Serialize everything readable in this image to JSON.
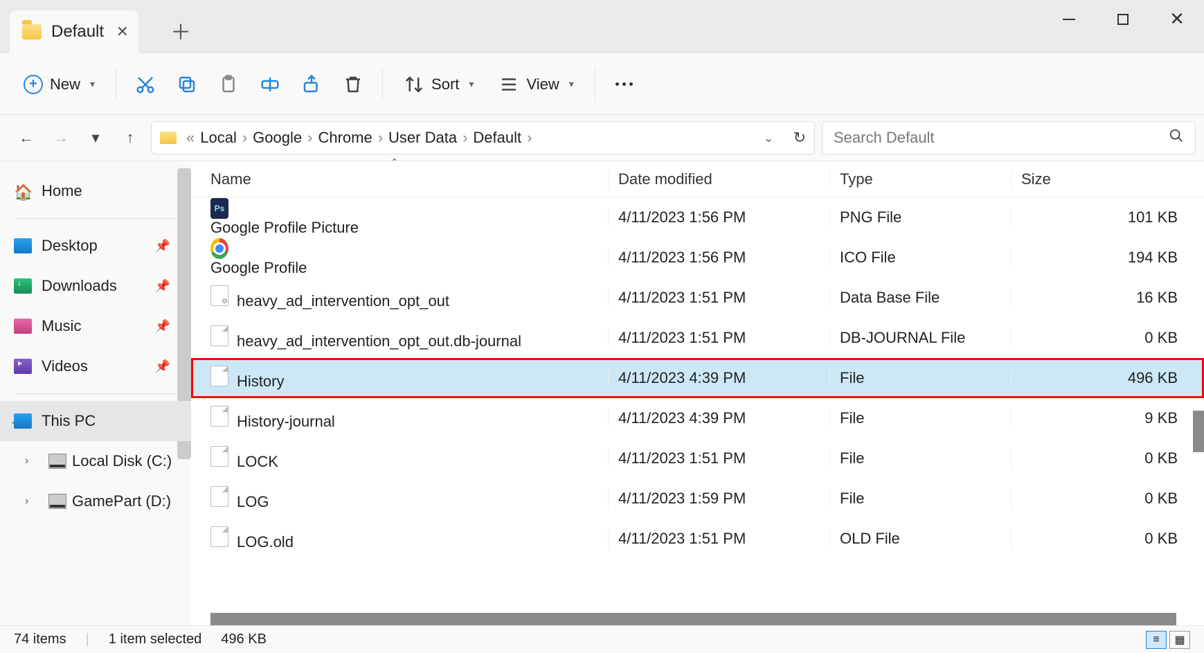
{
  "window": {
    "tab_title": "Default",
    "minimize": "–",
    "maximize": "□",
    "close": "✕"
  },
  "toolbar": {
    "new_label": "New",
    "sort_label": "Sort",
    "view_label": "View"
  },
  "nav": {
    "breadcrumbs": [
      "Local",
      "Google",
      "Chrome",
      "User Data",
      "Default"
    ],
    "search_placeholder": "Search Default"
  },
  "sidebar": {
    "home": "Home",
    "desktop": "Desktop",
    "downloads": "Downloads",
    "music": "Music",
    "videos": "Videos",
    "this_pc": "This PC",
    "local_disk": "Local Disk (C:)",
    "gamepart": "GamePart (D:)"
  },
  "columns": {
    "name": "Name",
    "date": "Date modified",
    "type": "Type",
    "size": "Size"
  },
  "files": [
    {
      "name": "Google Profile Picture",
      "date": "4/11/2023 1:56 PM",
      "type": "PNG File",
      "size": "101 KB",
      "icon": "ps",
      "selected": false
    },
    {
      "name": "Google Profile",
      "date": "4/11/2023 1:56 PM",
      "type": "ICO File",
      "size": "194 KB",
      "icon": "chrome",
      "selected": false
    },
    {
      "name": "heavy_ad_intervention_opt_out",
      "date": "4/11/2023 1:51 PM",
      "type": "Data Base File",
      "size": "16 KB",
      "icon": "db",
      "selected": false
    },
    {
      "name": "heavy_ad_intervention_opt_out.db-journal",
      "date": "4/11/2023 1:51 PM",
      "type": "DB-JOURNAL File",
      "size": "0 KB",
      "icon": "blank",
      "selected": false
    },
    {
      "name": "History",
      "date": "4/11/2023 4:39 PM",
      "type": "File",
      "size": "496 KB",
      "icon": "blank",
      "selected": true
    },
    {
      "name": "History-journal",
      "date": "4/11/2023 4:39 PM",
      "type": "File",
      "size": "9 KB",
      "icon": "blank",
      "selected": false
    },
    {
      "name": "LOCK",
      "date": "4/11/2023 1:51 PM",
      "type": "File",
      "size": "0 KB",
      "icon": "blank",
      "selected": false
    },
    {
      "name": "LOG",
      "date": "4/11/2023 1:59 PM",
      "type": "File",
      "size": "0 KB",
      "icon": "blank",
      "selected": false
    },
    {
      "name": "LOG.old",
      "date": "4/11/2023 1:51 PM",
      "type": "OLD File",
      "size": "0 KB",
      "icon": "blank",
      "selected": false
    }
  ],
  "status": {
    "total_items": "74 items",
    "selection": "1 item selected",
    "sel_size": "496 KB"
  }
}
